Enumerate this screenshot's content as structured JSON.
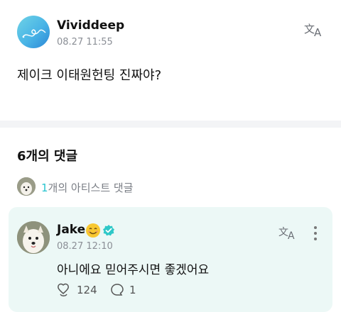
{
  "post": {
    "author": "Vividdeep",
    "time": "08.27 11:55",
    "body": "제이크 이태원헌팅 진짜야?"
  },
  "comments_section": {
    "title": "6개의 댓글",
    "artist_count": "1",
    "artist_label": "개의 아티스트 댓글"
  },
  "comment": {
    "author": "Jake",
    "time": "08.27 12:10",
    "text": "아니에요 믿어주시면 좋겠어요",
    "likes": "124",
    "replies": "1"
  },
  "colors": {
    "accent": "#28c4cf",
    "verified": "#2ec8c8",
    "card_bg": "#ecf8f6"
  },
  "icons": [
    "translate-icon",
    "smile-emoji-icon",
    "verified-badge-icon",
    "more-icon",
    "like-icon",
    "reply-icon"
  ]
}
